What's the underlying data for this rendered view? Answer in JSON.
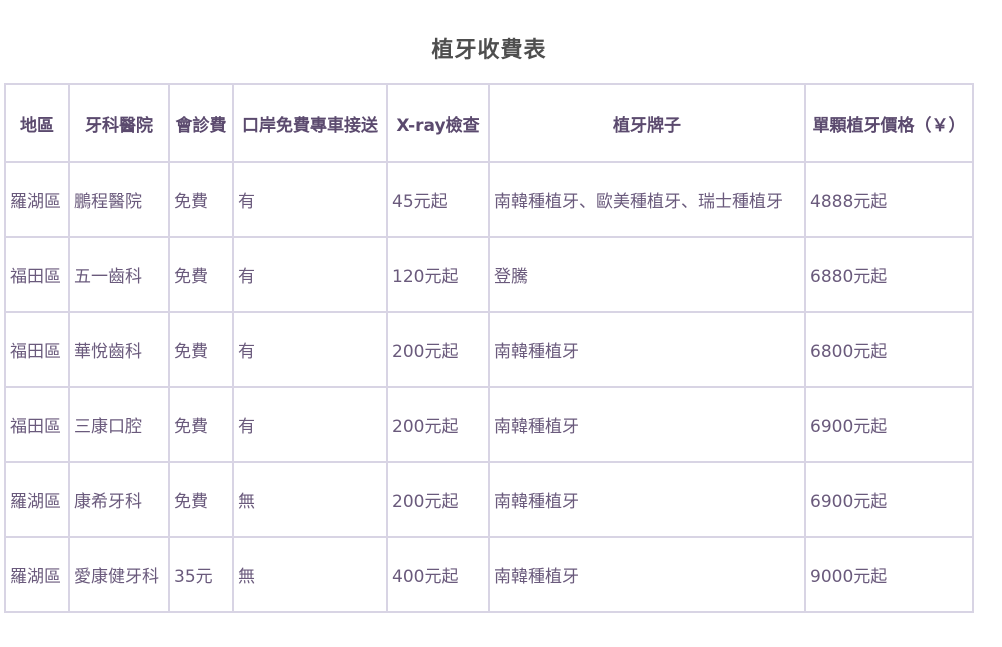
{
  "title": "植牙收費表",
  "table": {
    "headers": [
      "地區",
      "牙科醫院",
      "會診費",
      "口岸免費專車接送",
      "X-ray檢查",
      "植牙牌子",
      "單顆植牙價格（￥）"
    ],
    "rows": [
      [
        "羅湖區",
        "鵬程醫院",
        "免費",
        "有",
        "45元起",
        "南韓種植牙、歐美種植牙、瑞士種植牙",
        "4888元起"
      ],
      [
        "福田區",
        "五一齒科",
        "免費",
        "有",
        "120元起",
        "登騰",
        "6880元起"
      ],
      [
        "福田區",
        "華悅齒科",
        "免費",
        "有",
        "200元起",
        "南韓種植牙",
        "6800元起"
      ],
      [
        "福田區",
        "三康口腔",
        "免費",
        "有",
        "200元起",
        "南韓種植牙",
        "6900元起"
      ],
      [
        "羅湖區",
        "康希牙科",
        "免費",
        "無",
        "200元起",
        "南韓種植牙",
        "6900元起"
      ],
      [
        "羅湖區",
        "愛康健牙科",
        "35元",
        "無",
        "400元起",
        "南韓種植牙",
        "9000元起"
      ]
    ]
  }
}
